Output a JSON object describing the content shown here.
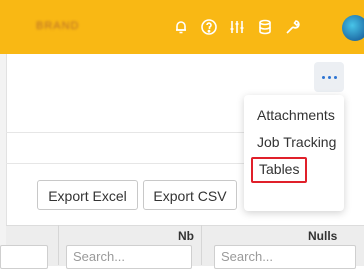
{
  "header": {
    "brand_text": "BRAND",
    "icons": [
      "bell-icon",
      "help-icon",
      "sliders-icon",
      "database-icon",
      "wrench-icon"
    ],
    "accent_color": "#f9b814"
  },
  "menu": {
    "more_label": "...",
    "items": [
      "Attachments",
      "Job Tracking",
      "Tables"
    ],
    "selected": "Tables",
    "highlight_color": "#e0202a"
  },
  "toolbar": {
    "export_excel": "Export Excel",
    "export_csv": "Export CSV",
    "icons": [
      "filter-icon",
      "settings-icon",
      "refresh-icon"
    ]
  },
  "grid": {
    "columns": [
      {
        "header": ""
      },
      {
        "header": "Nb"
      },
      {
        "header": "Nulls"
      }
    ],
    "search_placeholder": "Search..."
  }
}
